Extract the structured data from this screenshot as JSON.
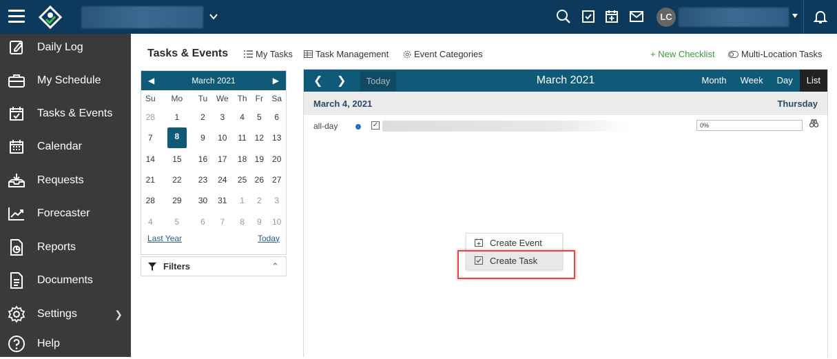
{
  "topbar": {
    "avatar_initials": "LC",
    "icons": [
      "menu-icon",
      "app-logo",
      "search-icon",
      "task-check-icon",
      "calendar-add-icon",
      "mail-icon",
      "bell-icon"
    ]
  },
  "sidebar": {
    "items": [
      {
        "label": "Daily Log",
        "icon": "edit-icon"
      },
      {
        "label": "My Schedule",
        "icon": "briefcase-icon"
      },
      {
        "label": "Tasks & Events",
        "icon": "calendar-check-icon"
      },
      {
        "label": "Calendar",
        "icon": "calendar-grid-icon"
      },
      {
        "label": "Requests",
        "icon": "inbox-icon"
      },
      {
        "label": "Forecaster",
        "icon": "trend-icon"
      },
      {
        "label": "Reports",
        "icon": "report-icon"
      },
      {
        "label": "Documents",
        "icon": "document-icon"
      },
      {
        "label": "Settings",
        "icon": "gear-icon"
      },
      {
        "label": "Help",
        "icon": "help-icon"
      }
    ]
  },
  "header": {
    "title": "Tasks & Events",
    "links": {
      "my_tasks": "My Tasks",
      "task_management": "Task Management",
      "event_categories": "Event Categories",
      "new_checklist": "+ New Checklist",
      "multi_location": "Multi-Location Tasks"
    }
  },
  "mini_calendar": {
    "month_label": "March 2021",
    "weekdays": [
      "Su",
      "Mo",
      "Tu",
      "We",
      "Th",
      "Fr",
      "Sa"
    ],
    "weeks": [
      [
        "28",
        "1",
        "2",
        "3",
        "4",
        "5",
        "6"
      ],
      [
        "7",
        "8",
        "9",
        "10",
        "11",
        "12",
        "13"
      ],
      [
        "14",
        "15",
        "16",
        "17",
        "18",
        "19",
        "20"
      ],
      [
        "21",
        "22",
        "23",
        "24",
        "25",
        "26",
        "27"
      ],
      [
        "28",
        "29",
        "30",
        "31",
        "1",
        "2",
        "3"
      ],
      [
        "4",
        "5",
        "6",
        "7",
        "8",
        "9",
        "10"
      ]
    ],
    "selected_day": "8",
    "last_year": "Last Year",
    "today": "Today"
  },
  "filters": {
    "label": "Filters"
  },
  "calendar": {
    "today_label": "Today",
    "title": "March 2021",
    "views": [
      "Month",
      "Week",
      "Day",
      "List"
    ],
    "active_view": "List",
    "date_label": "March 4, 2021",
    "weekday_label": "Thursday",
    "row": {
      "allday": "all-day",
      "percent": "0%"
    }
  },
  "context_menu": {
    "create_event": "Create Event",
    "create_task": "Create Task"
  },
  "colors": {
    "topbar": "#0d3a5c",
    "sidebar": "#3a3a3a",
    "calendar_header": "#0f5a78",
    "highlight": "#e24545",
    "link_green": "#3a9a3a"
  }
}
